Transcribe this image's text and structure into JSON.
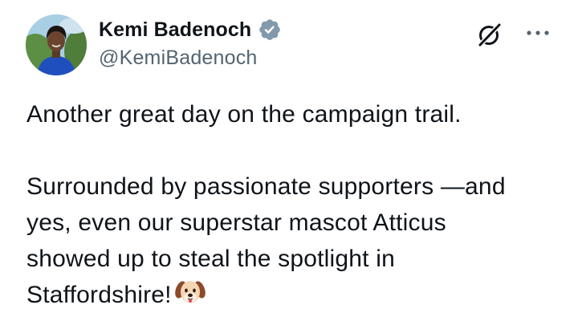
{
  "author": {
    "display_name": "Kemi Badenoch",
    "handle": "@KemiBadenoch",
    "verified": true,
    "avatar": "profile-photo"
  },
  "actions": {
    "grok_icon": "grok-icon",
    "more_icon": "more-options-icon"
  },
  "tweet": {
    "paragraph_1": "Another great day on the campaign trail.",
    "paragraph_2_line_1": "Surrounded by passionate supporters —and",
    "paragraph_2_line_2": "yes, even our superstar mascot Atticus",
    "paragraph_2_line_3": "showed up to steal the spotlight in",
    "paragraph_2_line_4": "Staffordshire!",
    "emoji": "dog-face-emoji"
  },
  "colors": {
    "text_primary": "#0f1419",
    "text_secondary": "#536471",
    "verified_badge": "#829aab"
  }
}
